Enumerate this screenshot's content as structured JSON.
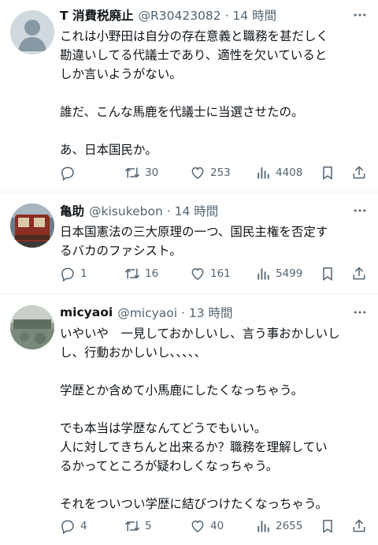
{
  "tweets": [
    {
      "display_name": "T 消費税廃止",
      "meta": "@R30423082 · 14 時間",
      "lines": [
        "これは小野田は自分の存在意義と職務を甚だしく",
        "勘違いしてる代議士であり、適性を欠いていると",
        "しか言いようがない。",
        "",
        "誰だ、こんな馬鹿を代議士に当選させたの。",
        "",
        "あ、日本国民か。"
      ],
      "replies": "",
      "retweets": "30",
      "likes": "253",
      "views": "4408"
    },
    {
      "display_name": "亀助",
      "meta": "@kisukebon · 14 時間",
      "lines": [
        "日本国憲法の三大原理の一つ、国民主権を否定す",
        "るバカのファシスト。"
      ],
      "replies": "1",
      "retweets": "16",
      "likes": "161",
      "views": "5499"
    },
    {
      "display_name": "micyaoi",
      "meta": "@micyaoi · 13 時間",
      "lines": [
        "いやいや　一見しておかしいし、言う事おかしいし",
        "し、行動おかしいし、、、、、",
        "",
        "学歴とか含めて小馬鹿にしたくなっちゃう。",
        "",
        "でも本当は学歴なんてどうでもいい。",
        "人に対してきちんと出来るか？職務を理解してい",
        "るかってところが疑わしくなっちゃう。",
        "",
        "それをついつい学歴に結びつけたくなっちゃう。"
      ],
      "replies": "4",
      "retweets": "5",
      "likes": "40",
      "views": "2655"
    }
  ],
  "icons": [
    "reply-icon",
    "retweet-icon",
    "like-icon",
    "views-icon",
    "bookmark-icon",
    "share-icon",
    "more-icon"
  ],
  "colors": {
    "text": "#0f1419",
    "secondary": "#536471",
    "divider": "#eff3f4"
  }
}
